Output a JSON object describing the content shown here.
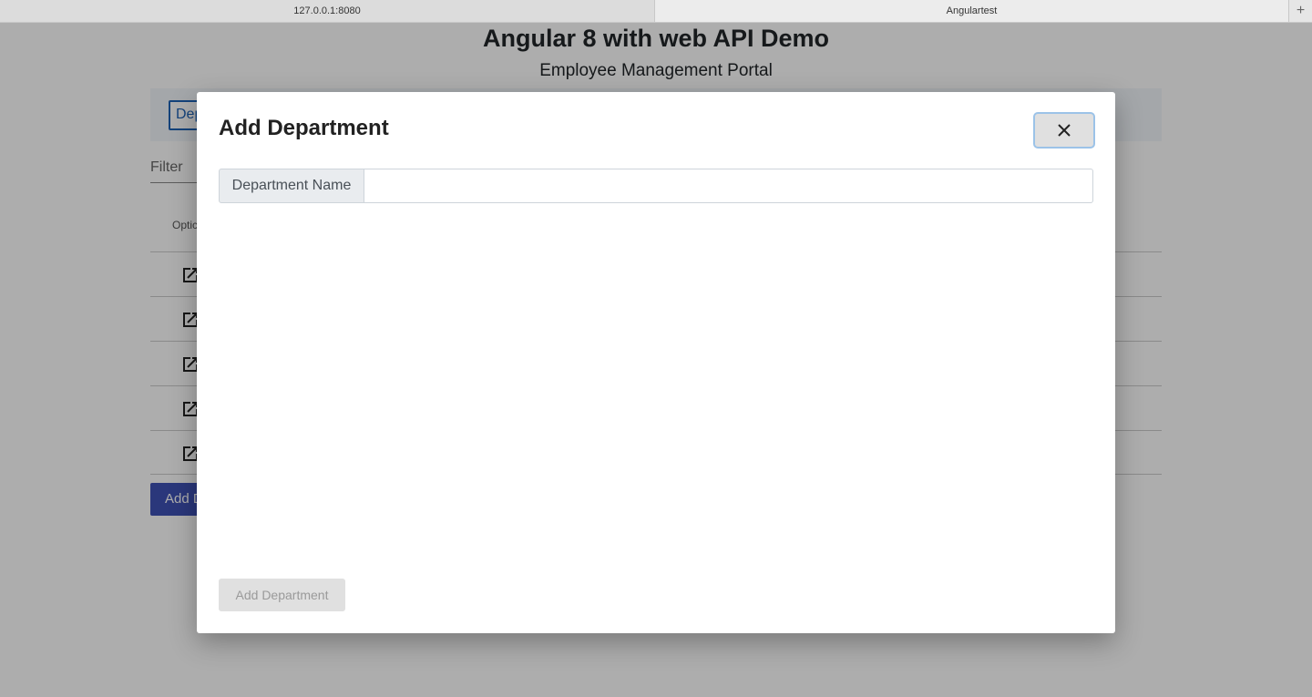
{
  "browser": {
    "tabs": [
      {
        "label": "127.0.0.1:8080"
      },
      {
        "label": "Angulartest"
      }
    ],
    "new_tab_symbol": "+"
  },
  "page": {
    "title": "Angular 8 with web API Demo",
    "subtitle": "Employee Management Portal",
    "nav_button_label": "Dep",
    "filter_placeholder": "Filter",
    "column_options_label": "Optic",
    "rows_count_visible": 5,
    "add_button_label": "Add D"
  },
  "modal": {
    "title": "Add Department",
    "close_icon": "close-icon",
    "field_label": "Department Name",
    "field_value": "",
    "submit_label": "Add Department"
  },
  "colors": {
    "primary": "#3f51b5",
    "nav_accent": "#1e63b6",
    "overlay": "rgba(0,0,0,0.32)"
  }
}
